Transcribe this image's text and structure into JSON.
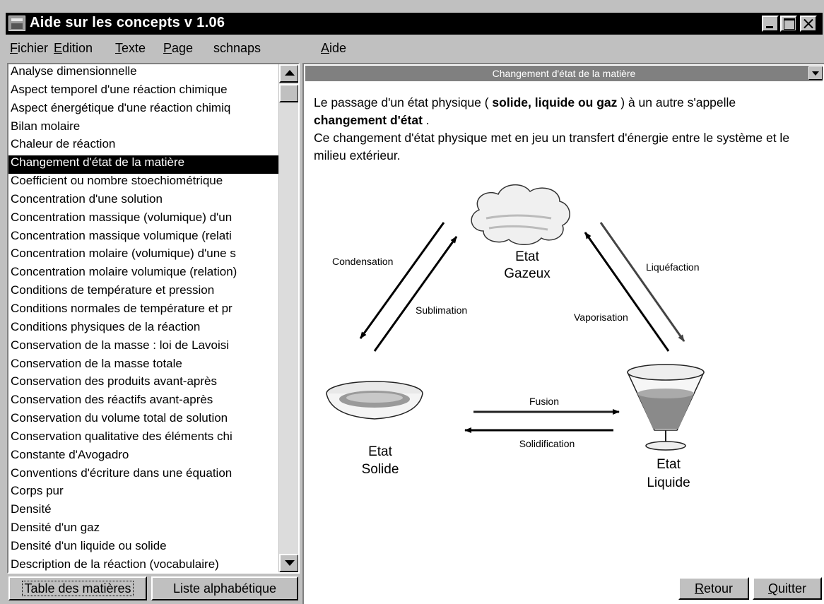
{
  "window": {
    "title": "Aide sur les concepts v 1.06"
  },
  "menu": [
    {
      "accel": "F",
      "rest": "ichier"
    },
    {
      "accel": "E",
      "rest": "dition"
    },
    {
      "accel": "T",
      "rest": "exte"
    },
    {
      "accel": "P",
      "rest": "age"
    },
    {
      "accel": "",
      "rest": "schnaps"
    },
    {
      "accel": "A",
      "rest": "ide"
    }
  ],
  "topics": [
    "Analyse dimensionnelle",
    "Aspect temporel d'une réaction chimique",
    "Aspect énergétique d'une réaction chimiq",
    "Bilan molaire",
    "Chaleur de réaction",
    "Changement d'état de la matière",
    "Coefficient ou nombre stoechiométrique",
    "Concentration d'une solution",
    "Concentration massique (volumique) d'un",
    "Concentration massique volumique (relati",
    "Concentration molaire (volumique) d'une s",
    "Concentration molaire volumique (relation)",
    "Conditions de température et pression",
    "Conditions normales de température et pr",
    "Conditions physiques de la réaction",
    "Conservation de la masse : loi de Lavoisi",
    "Conservation de la masse totale",
    "Conservation des produits avant-après",
    "Conservation des réactifs avant-après",
    "Conservation du volume total de solution",
    "Conservation qualitative des éléments chi",
    "Constante d'Avogadro",
    "Conventions d'écriture dans une équation",
    "Corps pur",
    "Densité",
    "Densité d'un gaz",
    "Densité d'un liquide ou solide",
    "Description de la réaction (vocabulaire)"
  ],
  "selected_topic_index": 5,
  "tabs": {
    "toc": "Table des matières",
    "alpha": "Liste alphabétique"
  },
  "pane": {
    "title": "Changement d'état de la matière",
    "intro_1": "Le passage d'un état physique ( ",
    "intro_bold_1": "solide, liquide ou gaz",
    "intro_2": " ) à un autre s'appelle ",
    "intro_bold_2": "changement d'état",
    "intro_3": " .",
    "intro_4": "Ce changement d'état physique met en jeu un transfert d'énergie entre le système et le milieu extérieur."
  },
  "diagram": {
    "gas_line1": "Etat",
    "gas_line2": "Gazeux",
    "solid_line1": "Etat",
    "solid_line2": "Solide",
    "liquid_line1": "Etat",
    "liquid_line2": "Liquide",
    "condensation": "Condensation",
    "sublimation": "Sublimation",
    "liquefaction": "Liquéfaction",
    "vaporisation": "Vaporisation",
    "fusion": "Fusion",
    "solidification": "Solidification"
  },
  "buttons": {
    "retour_accel": "R",
    "retour_rest": "etour",
    "quitter_accel": "Q",
    "quitter_rest": "uitter"
  }
}
